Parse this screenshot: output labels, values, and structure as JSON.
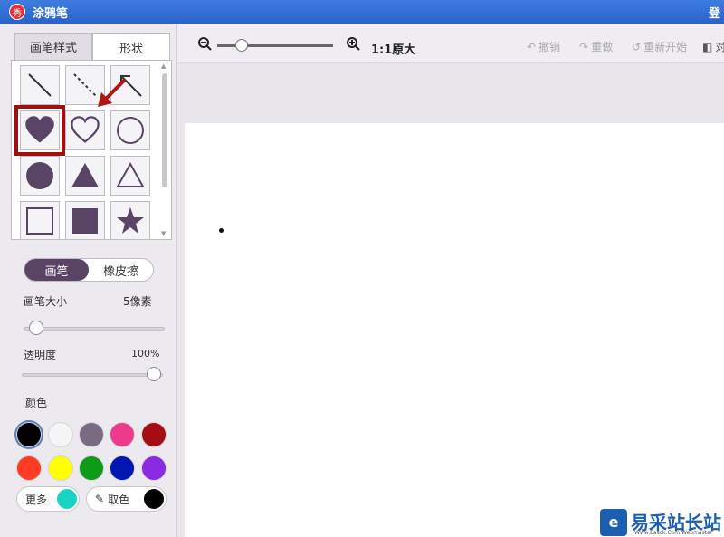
{
  "window": {
    "title": "涂鸦笔",
    "logo_char": "秀",
    "right_text": "登"
  },
  "tabs": [
    {
      "label": "画笔样式"
    },
    {
      "label": "形状"
    }
  ],
  "shapes": [
    "line-icon",
    "dashed-line-icon",
    "arrow-line-icon",
    "heart-filled-icon",
    "heart-outline-icon",
    "circle-outline-icon",
    "circle-filled-icon",
    "triangle-filled-icon",
    "triangle-outline-icon",
    "square-outline-icon",
    "square-filled-icon",
    "star-filled-icon"
  ],
  "mode": {
    "pen": "画笔",
    "eraser": "橡皮擦",
    "active": "pen"
  },
  "brush_size": {
    "label": "画笔大小",
    "value_text": "5像素",
    "value": 5
  },
  "opacity": {
    "label": "透明度",
    "value_text": "100%",
    "value": 1.0
  },
  "colors": {
    "label": "颜色",
    "swatches": [
      "#000000",
      "#f5f5f5",
      "#7a6b82",
      "#ee3a8c",
      "#a50d12",
      "#ff3b24",
      "#ffff00",
      "#0f9a1a",
      "#0018b0",
      "#8a2be2"
    ],
    "more": {
      "label": "更多",
      "color": "#19d3c4"
    },
    "picker": {
      "label": "取色",
      "color": "#000000"
    }
  },
  "toolbar": {
    "zoom_label": "1:1原大",
    "zoom_level": 0.18,
    "undo": "撤销",
    "redo": "重做",
    "restart": "重新开始",
    "compare": "对"
  },
  "watermark": {
    "logo": "e",
    "text": "易采站长站",
    "sub": "Www.Easck.Com  Webmaster"
  },
  "accent_colors": {
    "shape_fill": "#5a4466",
    "selection": "#a01010",
    "title_bar": "#2f6bd0"
  }
}
